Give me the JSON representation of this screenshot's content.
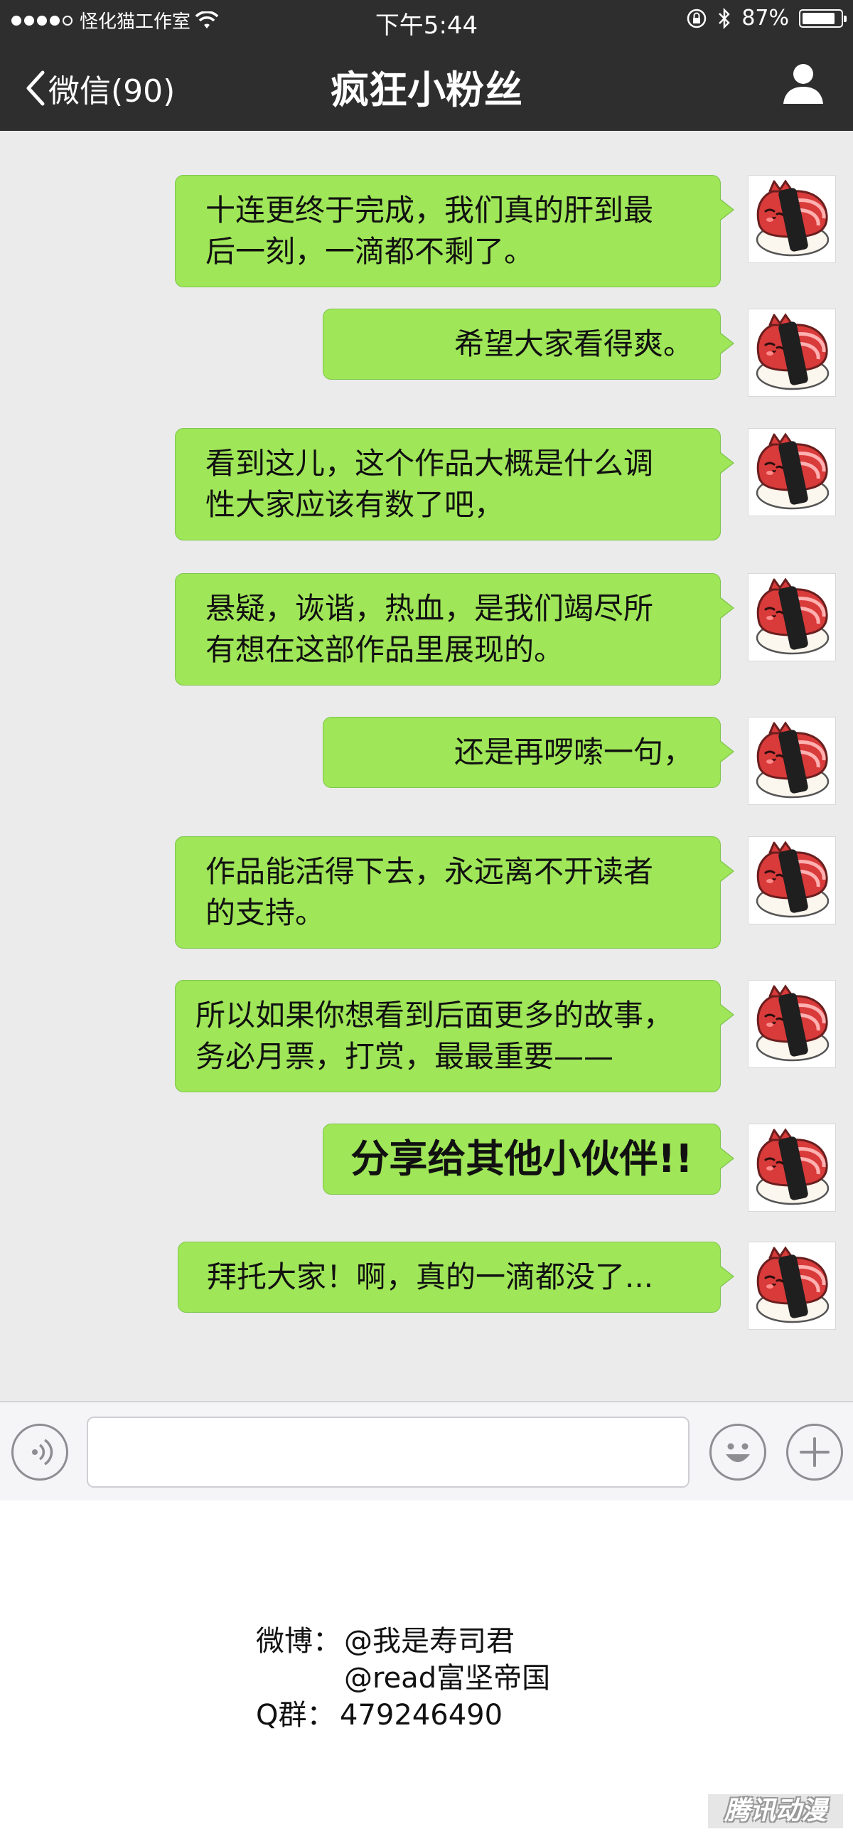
{
  "status_bar": {
    "carrier": "怪化猫工作室",
    "time": "下午5:44",
    "battery": "87%",
    "battery_level": 0.87
  },
  "nav": {
    "back_label": "微信(90)",
    "title": "疯狂小粉丝"
  },
  "messages": [
    {
      "text": "十连更终于完成，我们真的肝到最\n后一刻，一滴都不剩了。"
    },
    {
      "text": "希望大家看得爽。"
    },
    {
      "text": "看到这儿，这个作品大概是什么调\n性大家应该有数了吧，"
    },
    {
      "text": "悬疑，诙谐，热血，是我们竭尽所\n有想在这部作品里展现的。"
    },
    {
      "text": "还是再啰嗦一句，"
    },
    {
      "text": "作品能活得下去，永远离不开读者\n的支持。"
    },
    {
      "text": "所以如果你想看到后面更多的故事，\n务必月票，打赏，最最重要——"
    },
    {
      "text": "分享给其他小伙伴!!",
      "emphasis": true
    },
    {
      "text": "拜托大家！啊，真的一滴都没了..."
    }
  ],
  "input_bar": {
    "placeholder": ""
  },
  "credits": {
    "weibo_label": "微博：",
    "weibo_1": "@我是寿司君",
    "weibo_2": "@read富坚帝国",
    "qq_label": "Q群：",
    "qq_number": "479246490"
  },
  "watermark": "腾讯动漫",
  "colors": {
    "bubble": "#9fe658",
    "bar": "#2e2e2e",
    "chat_bg": "#ebebeb"
  }
}
